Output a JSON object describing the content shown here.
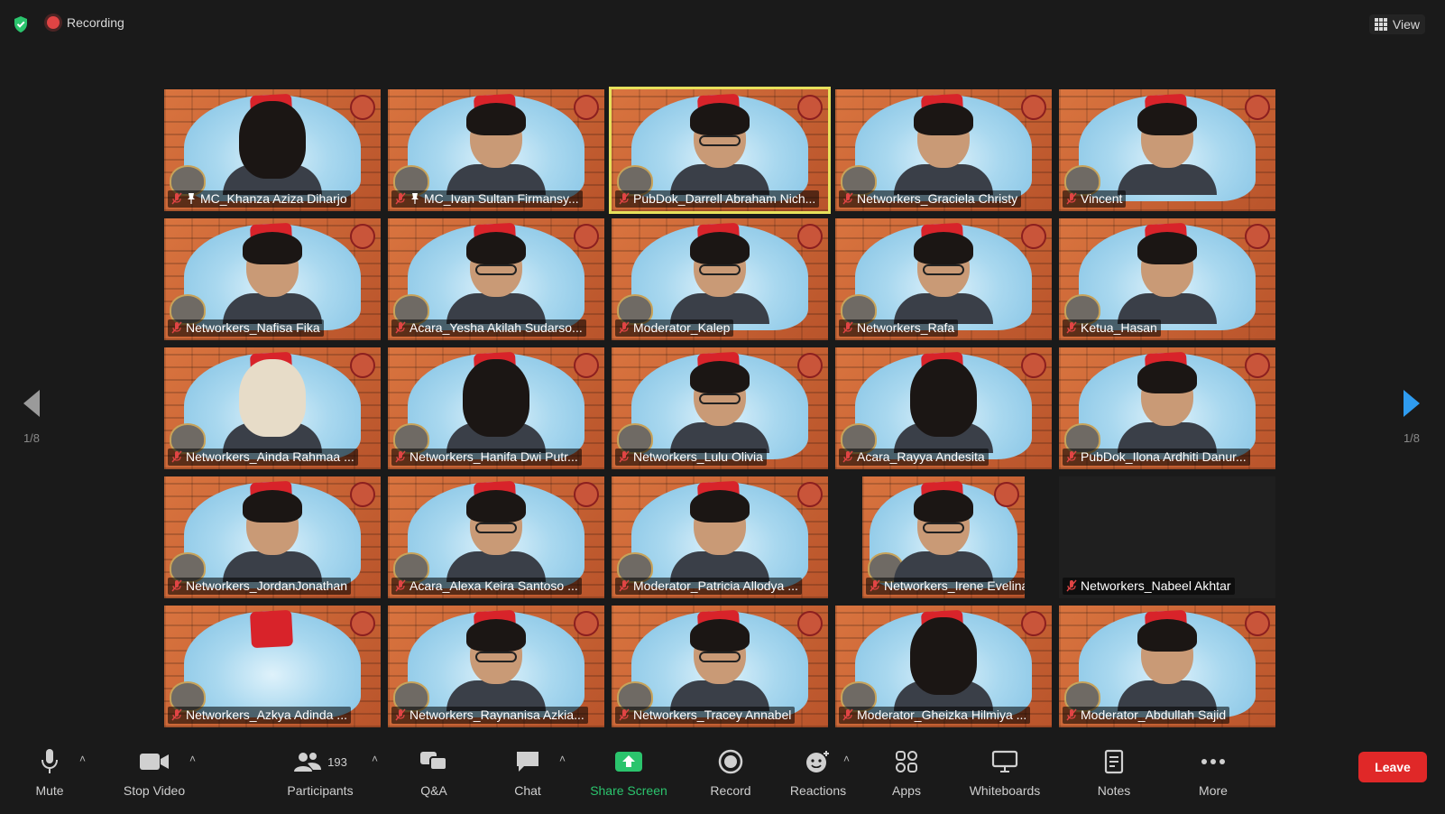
{
  "top": {
    "recording_label": "Recording",
    "view_label": "View"
  },
  "pager": {
    "left_label": "1/8",
    "right_label": "1/8"
  },
  "participants": [
    {
      "name": "MC_Khanza Aziza Diharjo",
      "pinned": true,
      "look": "hijab"
    },
    {
      "name": "MC_Ivan Sultan Firmansy...",
      "pinned": true,
      "look": "plain"
    },
    {
      "name": "PubDok_Darrell Abraham Nich...",
      "speaking": true,
      "look": "glasses"
    },
    {
      "name": "Networkers_Graciela Christy",
      "look": "plain"
    },
    {
      "name": "Vincent",
      "look": "plain"
    },
    {
      "name": "Networkers_Nafisa Fika",
      "look": "plain"
    },
    {
      "name": "Acara_Yesha Akilah Sudarso...",
      "look": "glasses"
    },
    {
      "name": "Moderator_Kalep",
      "look": "glasses"
    },
    {
      "name": "Networkers_Rafa",
      "look": "glasses"
    },
    {
      "name": "Ketua_Hasan",
      "look": "plain"
    },
    {
      "name": "Networkers_Ainda Rahmaa ...",
      "look": "hijab-light"
    },
    {
      "name": "Networkers_Hanifa Dwi Putr...",
      "look": "hijab"
    },
    {
      "name": "Networkers_Lulu Olivia",
      "look": "glasses"
    },
    {
      "name": "Acara_Rayya Andesita",
      "look": "hijab"
    },
    {
      "name": "PubDok_Ilona Ardhiti Danur...",
      "look": "plain"
    },
    {
      "name": "Networkers_JordanJonathan",
      "look": "plain"
    },
    {
      "name": "Acara_Alexa Keira Santoso ...",
      "look": "glasses"
    },
    {
      "name": "Moderator_Patricia Allodya ...",
      "look": "plain"
    },
    {
      "name": "Networkers_Irene Evelina",
      "look": "glasses",
      "narrow": true
    },
    {
      "name": "Networkers_Nabeel Akhtar",
      "video_off": true
    },
    {
      "name": "Networkers_Azkya Adinda ...",
      "look": "none"
    },
    {
      "name": "Networkers_Raynanisa Azkia...",
      "look": "glasses"
    },
    {
      "name": "Networkers_Tracey Annabel",
      "look": "glasses"
    },
    {
      "name": "Moderator_Gheizka Hilmiya ...",
      "look": "hijab"
    },
    {
      "name": "Moderator_Abdullah Sajid",
      "look": "plain"
    }
  ],
  "toolbar": {
    "mute": "Mute",
    "stop_video": "Stop Video",
    "participants": "Participants",
    "participants_count": "193",
    "qa": "Q&A",
    "chat": "Chat",
    "share_screen": "Share Screen",
    "record": "Record",
    "reactions": "Reactions",
    "apps": "Apps",
    "whiteboards": "Whiteboards",
    "notes": "Notes",
    "more": "More",
    "leave": "Leave"
  },
  "colors": {
    "accent_green": "#2bc46d",
    "leave_red": "#e02828",
    "speaking_border": "#e7e05c",
    "recording_red": "#e04444"
  }
}
